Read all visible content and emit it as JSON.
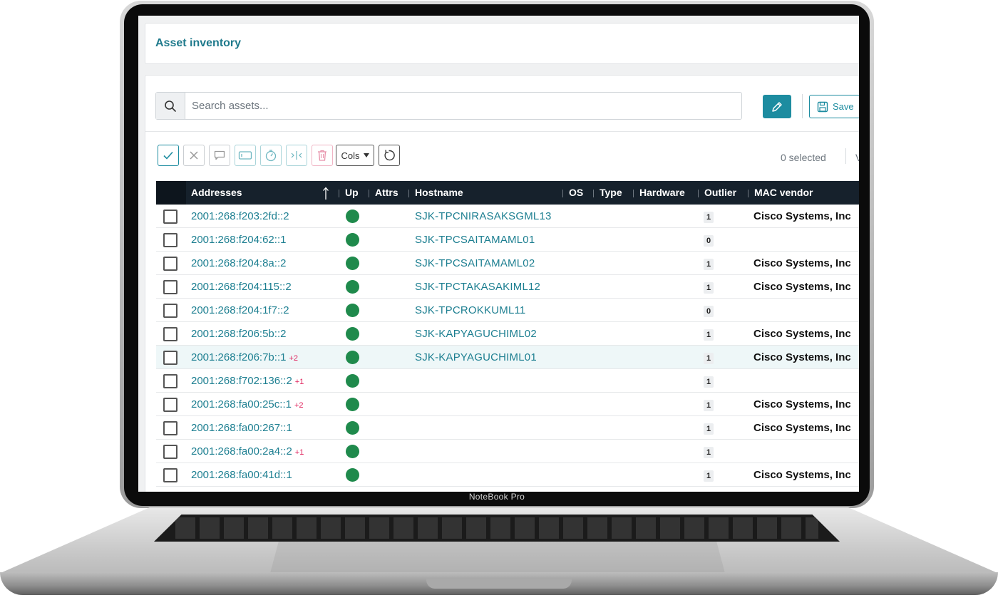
{
  "device": {
    "brand": "NoteBook Pro"
  },
  "page": {
    "title": "Asset inventory"
  },
  "search": {
    "placeholder": "Search assets..."
  },
  "toolbar": {
    "save_label": "Save",
    "cols_label": "Cols",
    "selected_text": "0 selected",
    "cut_text": "V"
  },
  "colors": {
    "accent": "#1d8ca0",
    "link": "#1d7f91",
    "up": "#1f8a4c",
    "extra": "#e0245e",
    "header_bg": "#16212c"
  },
  "table": {
    "columns": [
      "Addresses",
      "Up",
      "Attrs",
      "Hostname",
      "OS",
      "Type",
      "Hardware",
      "Outlier",
      "MAC vendor"
    ],
    "sort_icon": "sort-ascending-icon",
    "rows": [
      {
        "address": "2001:268:f203:2fd::2",
        "extra": "",
        "up": true,
        "hostname": "SJK-TPCNIRASAKSGML13",
        "outlier": "1",
        "vendor": "Cisco Systems, Inc"
      },
      {
        "address": "2001:268:f204:62::1",
        "extra": "",
        "up": true,
        "hostname": "SJK-TPCSAITAMAML01",
        "outlier": "0",
        "vendor": ""
      },
      {
        "address": "2001:268:f204:8a::2",
        "extra": "",
        "up": true,
        "hostname": "SJK-TPCSAITAMAML02",
        "outlier": "1",
        "vendor": "Cisco Systems, Inc"
      },
      {
        "address": "2001:268:f204:115::2",
        "extra": "",
        "up": true,
        "hostname": "SJK-TPCTAKASAKIML12",
        "outlier": "1",
        "vendor": "Cisco Systems, Inc"
      },
      {
        "address": "2001:268:f204:1f7::2",
        "extra": "",
        "up": true,
        "hostname": "SJK-TPCROKKUML11",
        "outlier": "0",
        "vendor": ""
      },
      {
        "address": "2001:268:f206:5b::2",
        "extra": "",
        "up": true,
        "hostname": "SJK-KAPYAGUCHIML02",
        "outlier": "1",
        "vendor": "Cisco Systems, Inc"
      },
      {
        "address": "2001:268:f206:7b::1",
        "extra": "+2",
        "up": true,
        "hostname": "SJK-KAPYAGUCHIML01",
        "outlier": "1",
        "vendor": "Cisco Systems, Inc"
      },
      {
        "address": "2001:268:f702:136::2",
        "extra": "+1",
        "up": true,
        "hostname": "",
        "outlier": "1",
        "vendor": ""
      },
      {
        "address": "2001:268:fa00:25c::1",
        "extra": "+2",
        "up": true,
        "hostname": "",
        "outlier": "1",
        "vendor": "Cisco Systems, Inc"
      },
      {
        "address": "2001:268:fa00:267::1",
        "extra": "",
        "up": true,
        "hostname": "",
        "outlier": "1",
        "vendor": "Cisco Systems, Inc"
      },
      {
        "address": "2001:268:fa00:2a4::2",
        "extra": "+1",
        "up": true,
        "hostname": "",
        "outlier": "1",
        "vendor": ""
      },
      {
        "address": "2001:268:fa00:41d::1",
        "extra": "",
        "up": true,
        "hostname": "",
        "outlier": "1",
        "vendor": "Cisco Systems, Inc"
      }
    ]
  }
}
